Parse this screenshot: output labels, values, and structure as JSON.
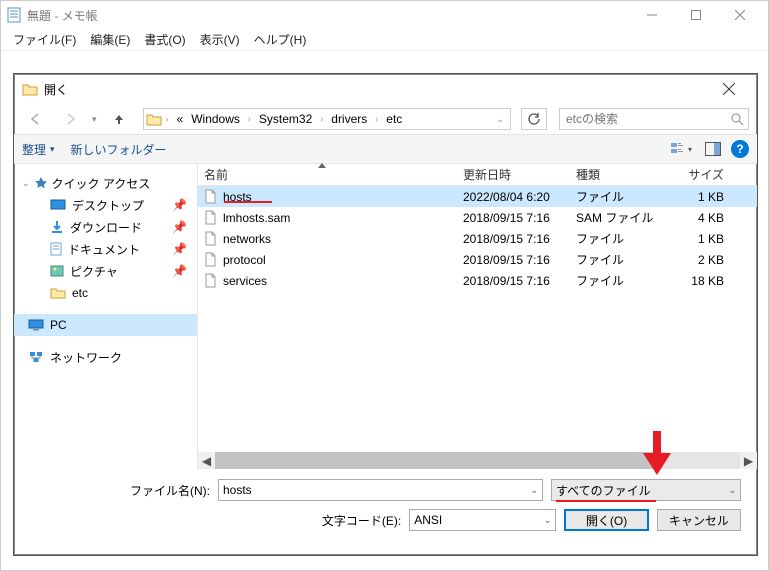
{
  "main": {
    "title": "無題 - メモ帳",
    "menu": [
      "ファイル(F)",
      "編集(E)",
      "書式(O)",
      "表示(V)",
      "ヘルプ(H)"
    ]
  },
  "dialog": {
    "title": "開く",
    "breadcrumb": {
      "prefix": "«",
      "items": [
        "Windows",
        "System32",
        "drivers",
        "etc"
      ]
    },
    "search_placeholder": "etcの検索",
    "toolbar": {
      "organize": "整理",
      "new_folder": "新しいフォルダー"
    },
    "columns": {
      "name": "名前",
      "modified": "更新日時",
      "type": "種類",
      "size": "サイズ"
    },
    "files": [
      {
        "name": "hosts",
        "modified": "2022/08/04 6:20",
        "type": "ファイル",
        "size": "1 KB",
        "selected": true,
        "redline": true
      },
      {
        "name": "lmhosts.sam",
        "modified": "2018/09/15 7:16",
        "type": "SAM ファイル",
        "size": "4 KB",
        "selected": false,
        "redline": false
      },
      {
        "name": "networks",
        "modified": "2018/09/15 7:16",
        "type": "ファイル",
        "size": "1 KB",
        "selected": false,
        "redline": false
      },
      {
        "name": "protocol",
        "modified": "2018/09/15 7:16",
        "type": "ファイル",
        "size": "2 KB",
        "selected": false,
        "redline": false
      },
      {
        "name": "services",
        "modified": "2018/09/15 7:16",
        "type": "ファイル",
        "size": "18 KB",
        "selected": false,
        "redline": false
      }
    ],
    "nav": {
      "quick_access": "クイック アクセス",
      "items": [
        {
          "label": "デスクトップ",
          "icon": "desktop"
        },
        {
          "label": "ダウンロード",
          "icon": "download"
        },
        {
          "label": "ドキュメント",
          "icon": "document"
        },
        {
          "label": "ピクチャ",
          "icon": "picture"
        },
        {
          "label": "etc",
          "icon": "folder",
          "no_pin": true
        }
      ],
      "pc": "PC",
      "network": "ネットワーク"
    },
    "footer": {
      "filename_label": "ファイル名(N):",
      "filename_value": "hosts",
      "filter": "すべてのファイル",
      "encoding_label": "文字コード(E):",
      "encoding_value": "ANSI",
      "open_btn": "開く(O)",
      "cancel_btn": "キャンセル"
    }
  }
}
